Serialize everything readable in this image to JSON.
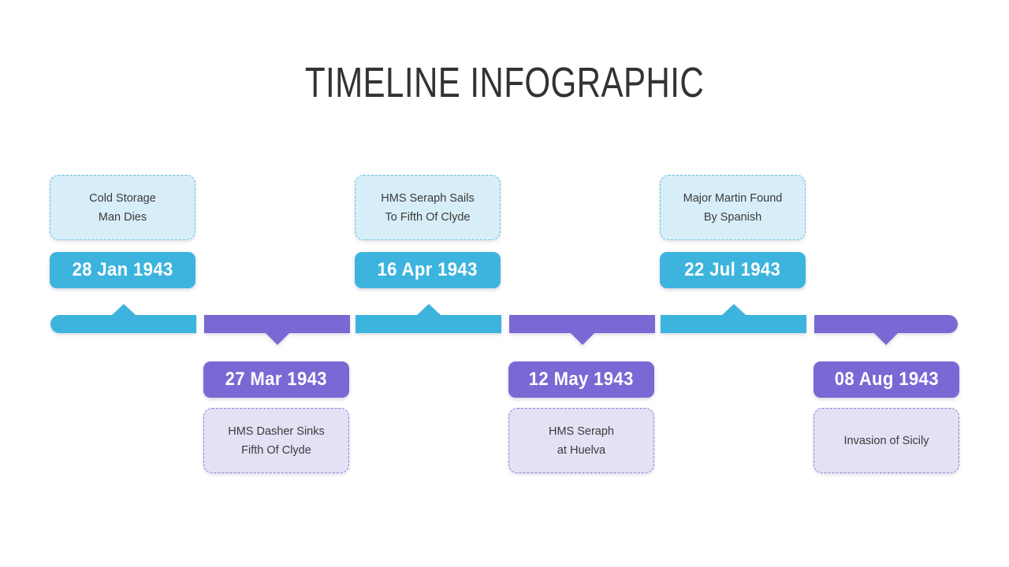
{
  "slide": {
    "title": "TIMELINE INFOGRAPHIC",
    "background": "#ffffff"
  },
  "theme": {
    "blue_solid": "#3db4de",
    "blue_fill": "#d7eef8",
    "blue_border": "#6cbfdd",
    "purple_solid": "#7a68d4",
    "purple_fill": "#e4e1f5",
    "purple_border": "#8b7cd8",
    "title_color": "#333333",
    "text_color": "#3b3b3b",
    "badge_text_color": "#ffffff"
  },
  "timeline": {
    "segment_count": 6,
    "events": [
      {
        "index": 1,
        "date": "28 Jan 1943",
        "description": "Cold Storage\nMan Dies",
        "description_line_1": "Cold Storage",
        "description_line_2": "Man Dies",
        "color": "blue",
        "position": "above",
        "pointer": "up"
      },
      {
        "index": 2,
        "date": "27 Mar 1943",
        "description": "HMS Dasher Sinks\nFifth Of Clyde",
        "description_line_1": "HMS Dasher Sinks",
        "description_line_2": "Fifth Of Clyde",
        "color": "purple",
        "position": "below",
        "pointer": "down"
      },
      {
        "index": 3,
        "date": "16 Apr 1943",
        "description": "HMS Seraph Sails\nTo Fifth Of Clyde",
        "description_line_1": "HMS Seraph Sails",
        "description_line_2": "To Fifth Of Clyde",
        "color": "blue",
        "position": "above",
        "pointer": "up"
      },
      {
        "index": 4,
        "date": "12 May 1943",
        "description": "HMS Seraph\nat Huelva",
        "description_line_1": "HMS Seraph",
        "description_line_2": "at Huelva",
        "color": "purple",
        "position": "below",
        "pointer": "down"
      },
      {
        "index": 5,
        "date": "22 Jul 1943",
        "description": "Major Martin Found\nBy Spanish",
        "description_line_1": "Major Martin Found",
        "description_line_2": "By Spanish",
        "color": "blue",
        "position": "above",
        "pointer": "up"
      },
      {
        "index": 6,
        "date": "08 Aug 1943",
        "description": "Invasion of Sicily",
        "description_line_1": "Invasion of Sicily",
        "description_line_2": "",
        "color": "purple",
        "position": "below",
        "pointer": "down"
      }
    ]
  }
}
